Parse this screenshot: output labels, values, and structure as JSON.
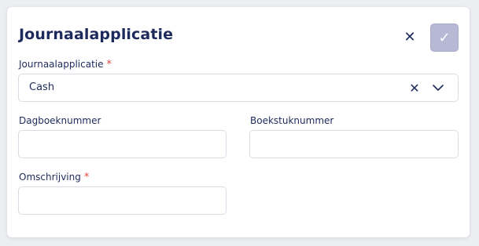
{
  "dialog": {
    "title": "Journaalapplicatie",
    "close_icon": "close-icon",
    "confirm_icon": "check-icon",
    "accent_color": "#1d2a5b",
    "confirm_color": "#b7b9d4",
    "required_color": "#e0473f"
  },
  "fields": {
    "journaalapplicatie": {
      "label": "Journaalapplicatie",
      "required": "*",
      "value": "Cash"
    },
    "dagboeknummer": {
      "label": "Dagboeknummer",
      "value": ""
    },
    "boekstuknummer": {
      "label": "Boekstuknummer",
      "value": ""
    },
    "omschrijving": {
      "label": "Omschrijving",
      "required": "*",
      "value": ""
    }
  }
}
